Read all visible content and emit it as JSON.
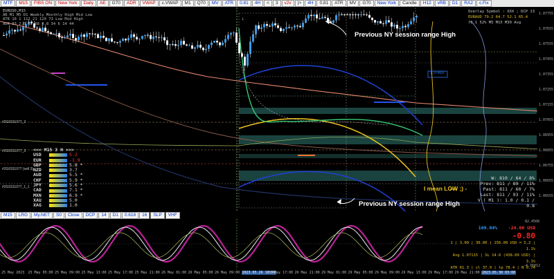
{
  "toolbar": {
    "buttons": [
      {
        "label": "MTF",
        "color": "blue"
      },
      {
        "label": "M15",
        "color": "red"
      },
      {
        "label": "FIBS ON",
        "color": "red"
      },
      {
        "label": "New York",
        "color": "red"
      },
      {
        "label": "Daily",
        "color": "red"
      },
      {
        "label": "AE",
        "color": "red"
      },
      {
        "label": "G70",
        "color": "dark"
      },
      {
        "label": "ADR",
        "color": "red"
      },
      {
        "label": "VWAP",
        "color": "red"
      },
      {
        "label": "c.VWAP",
        "color": "dark"
      },
      {
        "label": "M1",
        "color": "dark"
      },
      {
        "label": "Q70",
        "color": "dark"
      },
      {
        "label": "MV",
        "color": "blue"
      },
      {
        "label": "ATR",
        "color": "blue"
      },
      {
        "label": "0.81",
        "color": "blue"
      },
      {
        "label": "4H",
        "color": "blue"
      },
      {
        "label": "<",
        "color": "dark"
      },
      {
        "label": "3",
        "color": "dark"
      },
      {
        "label": "v2v",
        "color": "red"
      },
      {
        "label": "|>",
        "color": "dark"
      },
      {
        "label": "4H",
        "color": "blue"
      },
      {
        "label": "0.81",
        "color": "dark"
      },
      {
        "label": "ATR",
        "color": "dark"
      },
      {
        "label": "MV",
        "color": "dark"
      },
      {
        "label": "G70",
        "color": "dark"
      },
      {
        "label": "New York",
        "color": "blue"
      },
      {
        "label": "Candle",
        "color": "dark"
      },
      {
        "label": "H12",
        "color": "blue"
      },
      {
        "label": "vRB",
        "color": "blue"
      },
      {
        "label": "D1",
        "color": "blue"
      },
      {
        "label": "RA2",
        "color": "blue"
      },
      {
        "label": "c.Fix",
        "color": "blue"
      }
    ]
  },
  "chart": {
    "symbol_label": "EURUSD,M15",
    "top_left_table": [
      "AR   M1   M5   D1      Weekly   Monthly   High  Mid  Low",
      "ATR   10     1   112   21    120    73   Low  Mid  High",
      "ADR   93   2.0    52    68     0.8    34     6   14   44"
    ],
    "side_labels": [
      "#2G0311077_2",
      "#2G0311077_3",
      "#2G0311077 (sell 3)",
      "#2G0311077_1_1"
    ],
    "annotations": {
      "prev_ny_high_top": "Previous NY session range High",
      "prev_ny_high_bottom": "Previous NY session range High",
      "mean_low": "I mean LOW ;) -"
    },
    "price_ticks": [
      "1.07755",
      "1.07655",
      "1.07555",
      "1.07455",
      "1.07355",
      "1.07255",
      "1.07155",
      "1.07055",
      "1.06955",
      "1.06855",
      "1.06755",
      "1.06655",
      "1.06555"
    ],
    "box_label": "1.0746X"
  },
  "currency_strength": {
    "header": "<<<   M15  3  H   >>>",
    "rows": [
      {
        "name": "USD",
        "value": "5.2",
        "color": "#ff3333"
      },
      {
        "name": "EUR",
        "value": "-1.9",
        "color": "#ff3333"
      },
      {
        "name": "GBP",
        "value": "5.8 *",
        "color": "#dddddd"
      },
      {
        "name": "NZD",
        "value": "3.7",
        "color": "#dddddd"
      },
      {
        "name": "AUD",
        "value": "5.5 *",
        "color": "#dddddd"
      },
      {
        "name": "CHF",
        "value": "5.9 *",
        "color": "#dddddd"
      },
      {
        "name": "JPY",
        "value": "5.6 *",
        "color": "#dddddd"
      },
      {
        "name": "CAD",
        "value": "7.1 *",
        "color": "#dddddd"
      },
      {
        "name": "MXN",
        "value": "6.9 *",
        "color": "#dddddd"
      },
      {
        "name": "XAU",
        "value": "5.0",
        "color": "#dddddd"
      },
      {
        "name": "XAG",
        "value": "1.0",
        "color": "#dddddd"
      }
    ]
  },
  "overlay_box": {
    "line1": "Overlay Symbol : XXX ; DCP 13",
    "line2": "EURAUD  79.2  64.7  52.1  65.4",
    "line3": "70.1 52%    M5    M15   M30    Avg"
  },
  "stats_box": {
    "w": "W: 810 / 64 / 8%",
    "prev": "Prev: 811 / 89 / 11%",
    "past": "Past: 811 / 60 / 7%",
    "last": "Last: 811 / 93 / 11%",
    "v": "V ( M1 ): 1.0 / 0.1 / 0.8"
  },
  "indicator_toolbar": {
    "buttons": [
      "M15",
      "LRG",
      "My.NET",
      "S0",
      "Close",
      "DCP",
      "14",
      "D1",
      "0.618",
      "16",
      "SLP",
      "VHF"
    ]
  },
  "osc_stats": {
    "pct": "109.84%",
    "chg": "-24.00 USD",
    "big": "-0.80",
    "line1": "1  |  3.00  |  30.00  |  156.00 USD = 5.2  |  1.1%",
    "line2": "Avg 1.07115  |  SL 14.6 (438.00 USD)  |  3.1%",
    "line3": "ATR 61.3  |  sl 37.9  |  tp 78.4  |  N 0.74"
  },
  "osc_scale": {
    "top": "82.4568",
    "bottom": "-4.76012"
  },
  "timeline": {
    "ticks": [
      "25 May 2023",
      "25 May 05:00",
      "25 May 09:00",
      "25 May 13:00",
      "25 May 17:00",
      "25 May 21:00",
      "26 May 01:00",
      "26 May 05:00",
      "26 May 09:00",
      "2023.05.26 10:00",
      "26 May 17:00",
      "26 May 21:00",
      "29 May 01:00",
      "29 May 05:00",
      "29 May 09:00",
      "29 May 13:00",
      "29 May 17:00",
      "29 May 21:00",
      "2023.05.30 03:00"
    ]
  }
}
